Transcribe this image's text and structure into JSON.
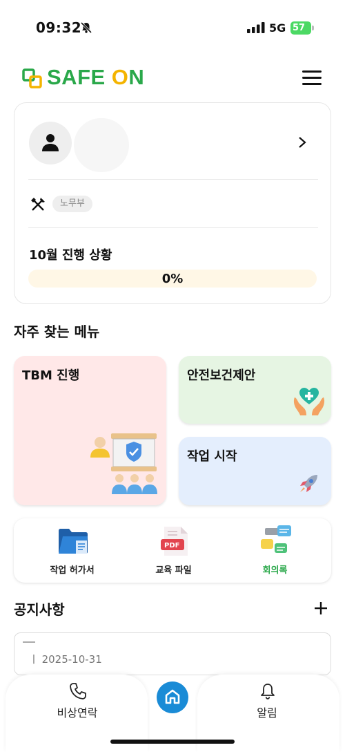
{
  "status_bar": {
    "time": "09:32",
    "network": "5G",
    "battery": "57"
  },
  "header": {
    "logo": "SAFE ON",
    "logo_prefix": "SAFE ",
    "logo_o": "O",
    "logo_suffix": "N"
  },
  "profile": {
    "department": "노무부",
    "progress_title": "10월 진행 상황",
    "progress_value": 0,
    "progress_text": "0%"
  },
  "quick_menu": {
    "title": "자주 찾는 메뉴",
    "tiles": [
      {
        "label": "TBM 진행",
        "color": "#ffe8e8"
      },
      {
        "label": "안전보건제안",
        "color": "#e6f5e3"
      },
      {
        "label": "작업 시작",
        "color": "#e4eefd"
      }
    ]
  },
  "documents": [
    {
      "label": "작업 허가서",
      "icon": "folder-icon"
    },
    {
      "label": "교육 파일",
      "icon": "pdf-file-icon"
    },
    {
      "label": "회의록",
      "icon": "chat-bubbles-icon"
    }
  ],
  "notices": {
    "title": "공지사항",
    "items": [
      {
        "date": "ㅣ 2025-10-31"
      }
    ]
  },
  "bottom_nav": {
    "emergency": "비상연락",
    "alerts": "알림"
  },
  "colors": {
    "brand_green": "#2aa84a",
    "brand_yellow": "#f4b400",
    "home_blue": "#1a8bd6"
  }
}
